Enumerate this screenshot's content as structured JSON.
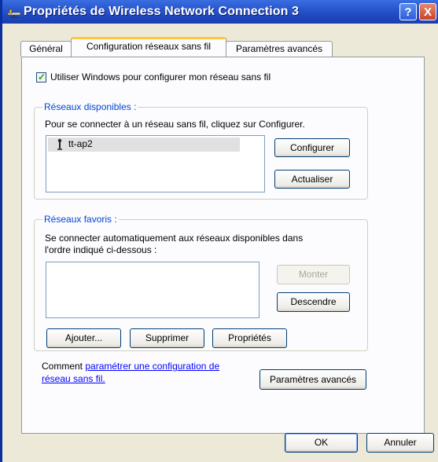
{
  "window": {
    "title": "Propriétés de Wireless Network Connection 3",
    "help_label": "?",
    "close_label": "X"
  },
  "tabs": [
    {
      "label": "Général",
      "active": false
    },
    {
      "label": "Configuration réseaux sans fil",
      "active": true
    },
    {
      "label": "Paramètres avancés",
      "active": false
    }
  ],
  "use_windows": {
    "label": "Utiliser Windows pour configurer mon réseau sans fil",
    "checked": true
  },
  "available": {
    "legend": "Réseaux disponibles :",
    "description": "Pour se connecter à un réseau sans fil, cliquez sur Configurer.",
    "networks": [
      "tt-ap2"
    ],
    "configure_label": "Configurer",
    "refresh_label": "Actualiser"
  },
  "preferred": {
    "legend": "Réseaux favoris :",
    "description_line1": "Se connecter automatiquement aux réseaux disponibles dans",
    "description_line2": "l'ordre indiqué ci-dessous :",
    "up_label": "Monter",
    "down_label": "Descendre",
    "add_label": "Ajouter...",
    "remove_label": "Supprimer",
    "properties_label": "Propriétés"
  },
  "footer": {
    "comment_prefix": "Comment",
    "link_line1": "paramétrer une configuration de",
    "link_line2": "réseau sans fil.",
    "advanced_label": "Paramètres avancés"
  },
  "dialog_buttons": {
    "ok_label": "OK",
    "cancel_label": "Annuler"
  }
}
